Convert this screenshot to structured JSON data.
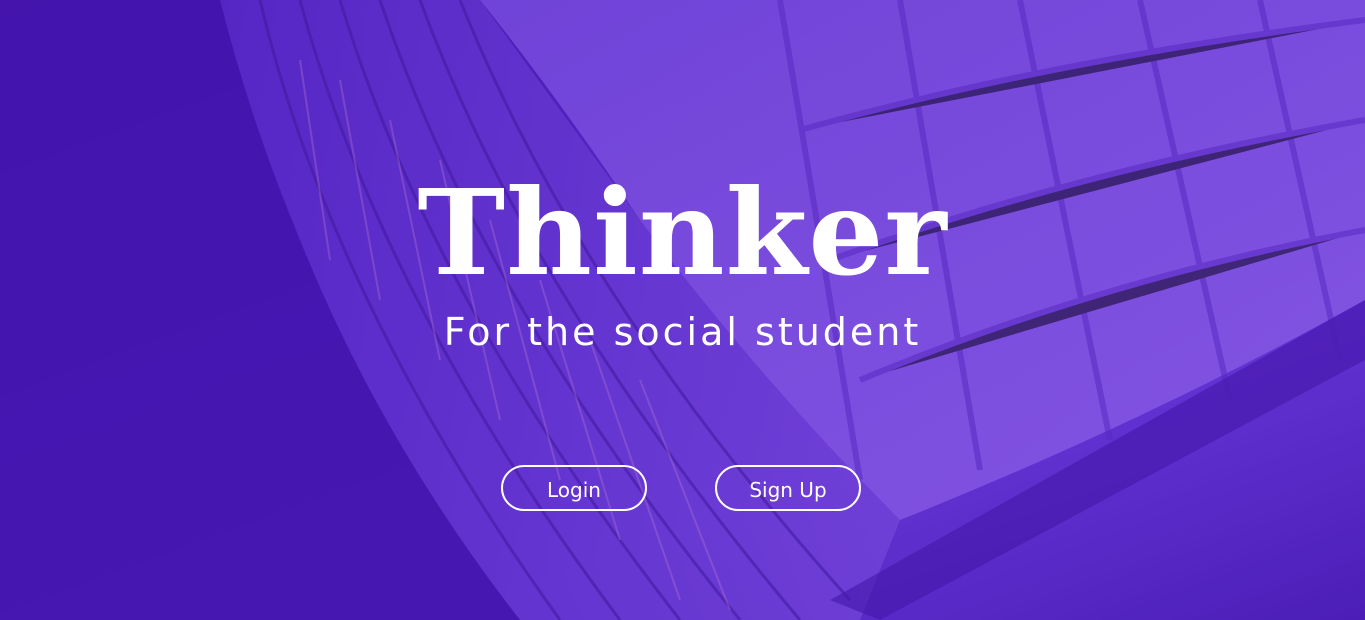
{
  "hero": {
    "title": "Thinker",
    "subtitle": "For the social student"
  },
  "actions": {
    "login_label": "Login",
    "signup_label": "Sign Up"
  },
  "colors": {
    "brand_purple": "#4a1fb0",
    "text": "#ffffff"
  }
}
